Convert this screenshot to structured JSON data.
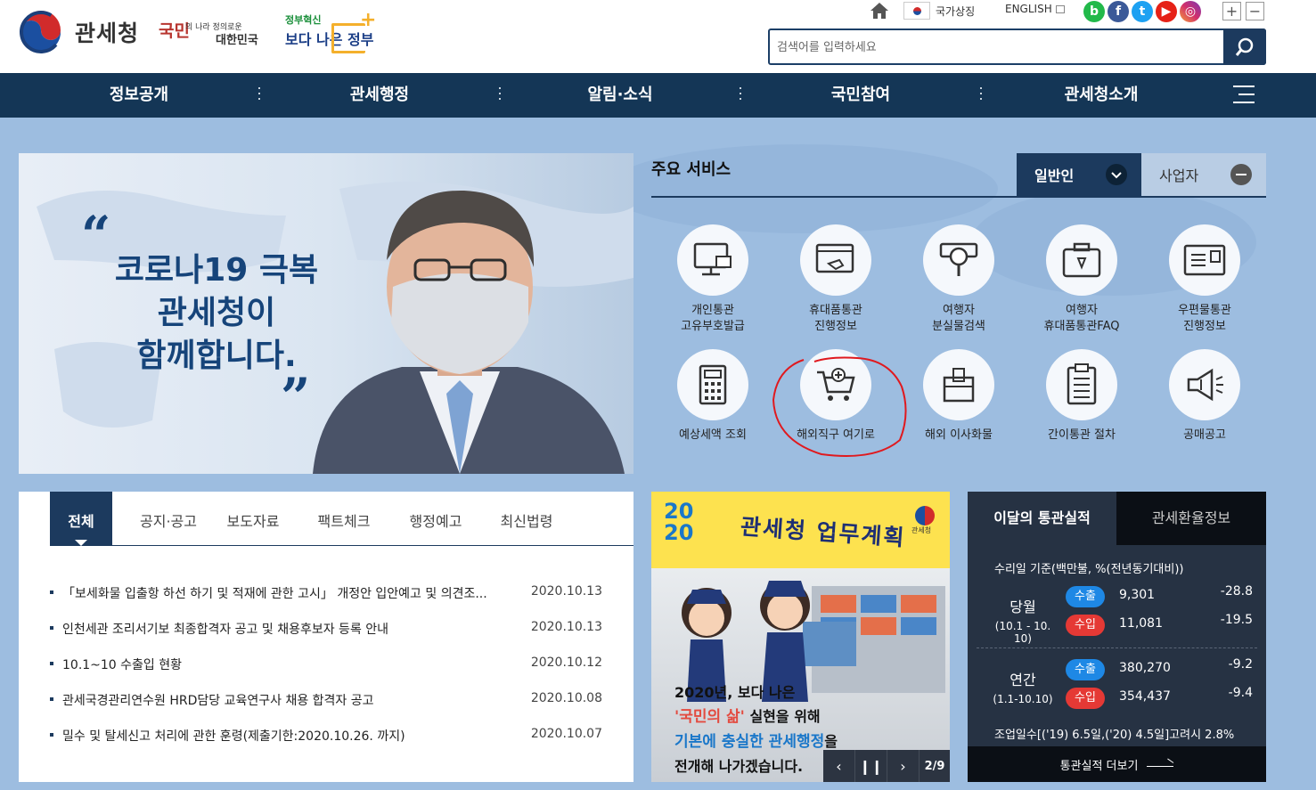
{
  "header": {
    "logo_text": "관세청",
    "slogan1": {
      "big": "국민",
      "small": "의 나라 정의로운",
      "korea": "대한민국"
    },
    "slogan2": {
      "top": "정부혁신",
      "main": "보다 나은 정부"
    },
    "symbol_label": "국가상징",
    "english_label": "ENGLISH",
    "sns": [
      "b",
      "f",
      "t",
      "▶",
      "◎"
    ],
    "zoom_in": "+",
    "zoom_out": "−",
    "search_placeholder": "검색어를 입력하세요"
  },
  "gnb": {
    "items": [
      "정보공개",
      "관세행정",
      "알림·소식",
      "국민참여",
      "관세청소개"
    ]
  },
  "banner": {
    "open_quote": "“",
    "close_quote": "”",
    "line1": "코로나19 극복",
    "line2": "관세청이",
    "line3": "함께합니다."
  },
  "services": {
    "title": "주요 서비스",
    "tab_general": "일반인",
    "tab_business": "사업자",
    "items": [
      {
        "line1": "개인통관",
        "line2": "고유부호발급",
        "icon": "monitor-card-icon"
      },
      {
        "line1": "휴대품통관",
        "line2": "진행정보",
        "icon": "browser-hand-icon"
      },
      {
        "line1": "여행자",
        "line2": "분실물검색",
        "icon": "magnifier-icon"
      },
      {
        "line1": "여행자",
        "line2": "휴대품통관FAQ",
        "icon": "suitcase-icon"
      },
      {
        "line1": "우편물통관",
        "line2": "진행정보",
        "icon": "postcard-icon"
      },
      {
        "line1": "예상세액 조회",
        "line2": "",
        "icon": "calculator-icon"
      },
      {
        "line1": "해외직구 여기로",
        "line2": "",
        "icon": "cart-icon"
      },
      {
        "line1": "해외 이사화물",
        "line2": "",
        "icon": "box-icon"
      },
      {
        "line1": "간이통관 절차",
        "line2": "",
        "icon": "clipboard-icon"
      },
      {
        "line1": "공매공고",
        "line2": "",
        "icon": "megaphone-icon"
      }
    ]
  },
  "notices": {
    "tabs": [
      "전체",
      "공지·공고",
      "보도자료",
      "팩트체크",
      "행정예고",
      "최신법령"
    ],
    "items": [
      {
        "title": "「보세화물 입출항 하선 하기 및 적재에 관한 고시」 개정안 입안예고 및 의견조...",
        "date": "2020.10.13"
      },
      {
        "title": "인천세관 조리서기보 최종합격자 공고 및 채용후보자 등록 안내",
        "date": "2020.10.13"
      },
      {
        "title": "10.1~10 수출입 현황",
        "date": "2020.10.12"
      },
      {
        "title": "관세국경관리연수원 HRD담당 교육연구사 채용 합격자 공고",
        "date": "2020.10.08"
      },
      {
        "title": "밀수 및 탈세신고 처리에 관한 훈령(제출기한:2020.10.26. 까지)",
        "date": "2020.10.07"
      }
    ]
  },
  "plan": {
    "year_top": "20",
    "year_bottom": "20",
    "title": "관세청 업무계획",
    "logo_text": "관세청",
    "line1": "2020년, 보다 나은",
    "line2_hl": "'국민의 삶'",
    "line2_rest": " 실현을 위해",
    "line3_hl": "기본에 충실한 관세행정",
    "line3_rest": "을",
    "line4": "전개해 나가겠습니다.",
    "prev": "‹",
    "pause": "❙❙",
    "next": "›",
    "page": "2/9"
  },
  "stats": {
    "tab_on": "이달의 통관실적",
    "tab_off": "관세환율정보",
    "basis": "수리일 기준(백만불, %(전년동기대비))",
    "blocks": [
      {
        "name": "당월",
        "range": "(10.1 - 10. 10)",
        "export_label": "수출",
        "export_amount": "9,301",
        "export_change": "-28.8",
        "import_label": "수입",
        "import_amount": "11,081",
        "import_change": "-19.5"
      },
      {
        "name": "연간",
        "range": "(1.1-10.10)",
        "export_label": "수출",
        "export_amount": "380,270",
        "export_change": "-9.2",
        "import_label": "수입",
        "import_amount": "354,437",
        "import_change": "-9.4"
      }
    ],
    "workdays": "조업일수[('19) 6.5일,('20) 4.5일]고려시 2.8%",
    "more_label": "통관실적 더보기"
  },
  "colors": {
    "navy": "#143656",
    "bg_blue": "#9dbde0",
    "stats_bg": "#263243",
    "export_badge": "#1e88e5",
    "import_badge": "#e53935",
    "annotation_red": "#e0191e"
  }
}
